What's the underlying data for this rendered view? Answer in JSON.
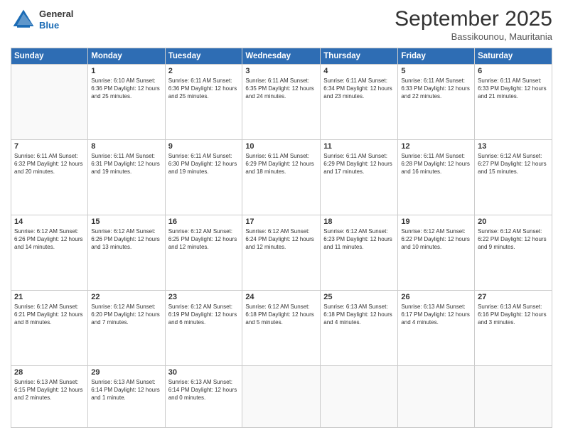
{
  "header": {
    "logo": {
      "general": "General",
      "blue": "Blue"
    },
    "title": "September 2025",
    "location": "Bassikounou, Mauritania"
  },
  "calendar": {
    "days": [
      "Sunday",
      "Monday",
      "Tuesday",
      "Wednesday",
      "Thursday",
      "Friday",
      "Saturday"
    ],
    "weeks": [
      [
        {
          "day": "",
          "info": ""
        },
        {
          "day": "1",
          "info": "Sunrise: 6:10 AM\nSunset: 6:36 PM\nDaylight: 12 hours\nand 25 minutes."
        },
        {
          "day": "2",
          "info": "Sunrise: 6:11 AM\nSunset: 6:36 PM\nDaylight: 12 hours\nand 25 minutes."
        },
        {
          "day": "3",
          "info": "Sunrise: 6:11 AM\nSunset: 6:35 PM\nDaylight: 12 hours\nand 24 minutes."
        },
        {
          "day": "4",
          "info": "Sunrise: 6:11 AM\nSunset: 6:34 PM\nDaylight: 12 hours\nand 23 minutes."
        },
        {
          "day": "5",
          "info": "Sunrise: 6:11 AM\nSunset: 6:33 PM\nDaylight: 12 hours\nand 22 minutes."
        },
        {
          "day": "6",
          "info": "Sunrise: 6:11 AM\nSunset: 6:33 PM\nDaylight: 12 hours\nand 21 minutes."
        }
      ],
      [
        {
          "day": "7",
          "info": "Sunrise: 6:11 AM\nSunset: 6:32 PM\nDaylight: 12 hours\nand 20 minutes."
        },
        {
          "day": "8",
          "info": "Sunrise: 6:11 AM\nSunset: 6:31 PM\nDaylight: 12 hours\nand 19 minutes."
        },
        {
          "day": "9",
          "info": "Sunrise: 6:11 AM\nSunset: 6:30 PM\nDaylight: 12 hours\nand 19 minutes."
        },
        {
          "day": "10",
          "info": "Sunrise: 6:11 AM\nSunset: 6:29 PM\nDaylight: 12 hours\nand 18 minutes."
        },
        {
          "day": "11",
          "info": "Sunrise: 6:11 AM\nSunset: 6:29 PM\nDaylight: 12 hours\nand 17 minutes."
        },
        {
          "day": "12",
          "info": "Sunrise: 6:11 AM\nSunset: 6:28 PM\nDaylight: 12 hours\nand 16 minutes."
        },
        {
          "day": "13",
          "info": "Sunrise: 6:12 AM\nSunset: 6:27 PM\nDaylight: 12 hours\nand 15 minutes."
        }
      ],
      [
        {
          "day": "14",
          "info": "Sunrise: 6:12 AM\nSunset: 6:26 PM\nDaylight: 12 hours\nand 14 minutes."
        },
        {
          "day": "15",
          "info": "Sunrise: 6:12 AM\nSunset: 6:26 PM\nDaylight: 12 hours\nand 13 minutes."
        },
        {
          "day": "16",
          "info": "Sunrise: 6:12 AM\nSunset: 6:25 PM\nDaylight: 12 hours\nand 12 minutes."
        },
        {
          "day": "17",
          "info": "Sunrise: 6:12 AM\nSunset: 6:24 PM\nDaylight: 12 hours\nand 12 minutes."
        },
        {
          "day": "18",
          "info": "Sunrise: 6:12 AM\nSunset: 6:23 PM\nDaylight: 12 hours\nand 11 minutes."
        },
        {
          "day": "19",
          "info": "Sunrise: 6:12 AM\nSunset: 6:22 PM\nDaylight: 12 hours\nand 10 minutes."
        },
        {
          "day": "20",
          "info": "Sunrise: 6:12 AM\nSunset: 6:22 PM\nDaylight: 12 hours\nand 9 minutes."
        }
      ],
      [
        {
          "day": "21",
          "info": "Sunrise: 6:12 AM\nSunset: 6:21 PM\nDaylight: 12 hours\nand 8 minutes."
        },
        {
          "day": "22",
          "info": "Sunrise: 6:12 AM\nSunset: 6:20 PM\nDaylight: 12 hours\nand 7 minutes."
        },
        {
          "day": "23",
          "info": "Sunrise: 6:12 AM\nSunset: 6:19 PM\nDaylight: 12 hours\nand 6 minutes."
        },
        {
          "day": "24",
          "info": "Sunrise: 6:12 AM\nSunset: 6:18 PM\nDaylight: 12 hours\nand 5 minutes."
        },
        {
          "day": "25",
          "info": "Sunrise: 6:13 AM\nSunset: 6:18 PM\nDaylight: 12 hours\nand 4 minutes."
        },
        {
          "day": "26",
          "info": "Sunrise: 6:13 AM\nSunset: 6:17 PM\nDaylight: 12 hours\nand 4 minutes."
        },
        {
          "day": "27",
          "info": "Sunrise: 6:13 AM\nSunset: 6:16 PM\nDaylight: 12 hours\nand 3 minutes."
        }
      ],
      [
        {
          "day": "28",
          "info": "Sunrise: 6:13 AM\nSunset: 6:15 PM\nDaylight: 12 hours\nand 2 minutes."
        },
        {
          "day": "29",
          "info": "Sunrise: 6:13 AM\nSunset: 6:14 PM\nDaylight: 12 hours\nand 1 minute."
        },
        {
          "day": "30",
          "info": "Sunrise: 6:13 AM\nSunset: 6:14 PM\nDaylight: 12 hours\nand 0 minutes."
        },
        {
          "day": "",
          "info": ""
        },
        {
          "day": "",
          "info": ""
        },
        {
          "day": "",
          "info": ""
        },
        {
          "day": "",
          "info": ""
        }
      ]
    ]
  }
}
